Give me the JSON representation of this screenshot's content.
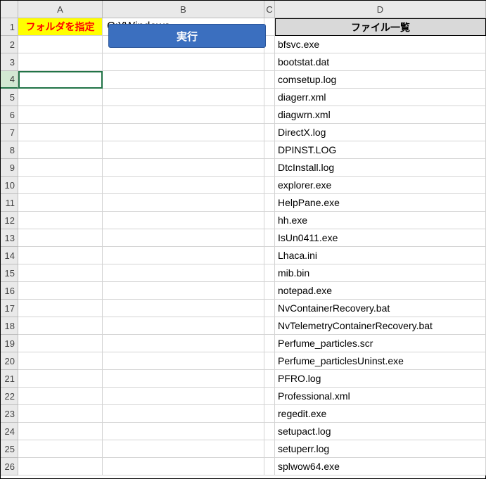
{
  "columns": [
    "A",
    "B",
    "C",
    "D"
  ],
  "rowCount": 26,
  "activeRow": 4,
  "labels": {
    "folderLabel": "フォルダを指定",
    "folderPath": "C:¥Windows",
    "fileListHeader": "ファイル一覧",
    "execButton": "実行"
  },
  "files": [
    "bfsvc.exe",
    "bootstat.dat",
    "comsetup.log",
    "diagerr.xml",
    "diagwrn.xml",
    "DirectX.log",
    "DPINST.LOG",
    "DtcInstall.log",
    "explorer.exe",
    "HelpPane.exe",
    "hh.exe",
    "IsUn0411.exe",
    "Lhaca.ini",
    "mib.bin",
    "notepad.exe",
    "NvContainerRecovery.bat",
    "NvTelemetryContainerRecovery.bat",
    "Perfume_particles.scr",
    "Perfume_particlesUninst.exe",
    "PFRO.log",
    "Professional.xml",
    "regedit.exe",
    "setupact.log",
    "setuperr.log",
    "splwow64.exe"
  ]
}
